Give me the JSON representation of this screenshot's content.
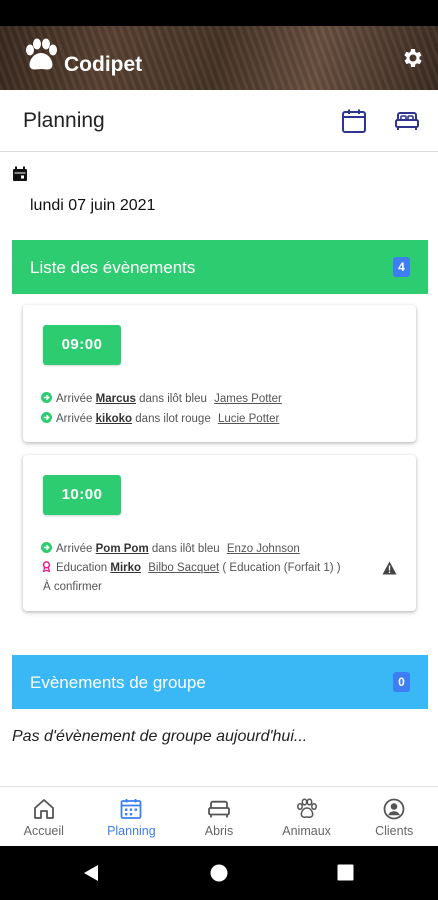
{
  "app": {
    "title": "Codipet"
  },
  "page": {
    "title": "Planning"
  },
  "date": {
    "label": "lundi 07 juin 2021"
  },
  "events_section": {
    "title": "Liste des évènements",
    "count": "4",
    "color": "#2ecc71",
    "badge_color": "#3d7ef2",
    "slots": [
      {
        "time": "09:00",
        "lines": [
          {
            "type": "Arrivée",
            "pet": "Marcus",
            "location": "dans ilôt bleu",
            "owner": "James Potter"
          },
          {
            "type": "Arrivée",
            "pet": "kikoko",
            "location": "dans ilot rouge",
            "owner": "Lucie Potter"
          }
        ]
      },
      {
        "time": "10:00",
        "lines": [
          {
            "type": "Arrivée",
            "pet": "Pom Pom",
            "location": "dans ilôt bleu",
            "owner": "Enzo Johnson"
          },
          {
            "type": "Education",
            "pet": "Mirko",
            "owner": "Bilbo Sacquet",
            "detail": "( Education (Forfait 1) )"
          }
        ],
        "status": "À confirmer"
      }
    ]
  },
  "group_section": {
    "title": "Evènements de groupe",
    "count": "0",
    "color": "#3ab8f5",
    "empty_message": "Pas d'évènement de groupe aujourd'hui..."
  },
  "bottom_nav": {
    "active": "Planning",
    "items": [
      {
        "label": "Accueil",
        "icon": "home-icon"
      },
      {
        "label": "Planning",
        "icon": "calendar-icon"
      },
      {
        "label": "Abris",
        "icon": "bed-icon"
      },
      {
        "label": "Animaux",
        "icon": "paw-icon"
      },
      {
        "label": "Clients",
        "icon": "user-circle-icon"
      }
    ]
  },
  "colors": {
    "accent": "#3d7ef2",
    "green": "#2ecc71",
    "blue": "#3ab8f5",
    "icon_navy": "#2d3590"
  }
}
